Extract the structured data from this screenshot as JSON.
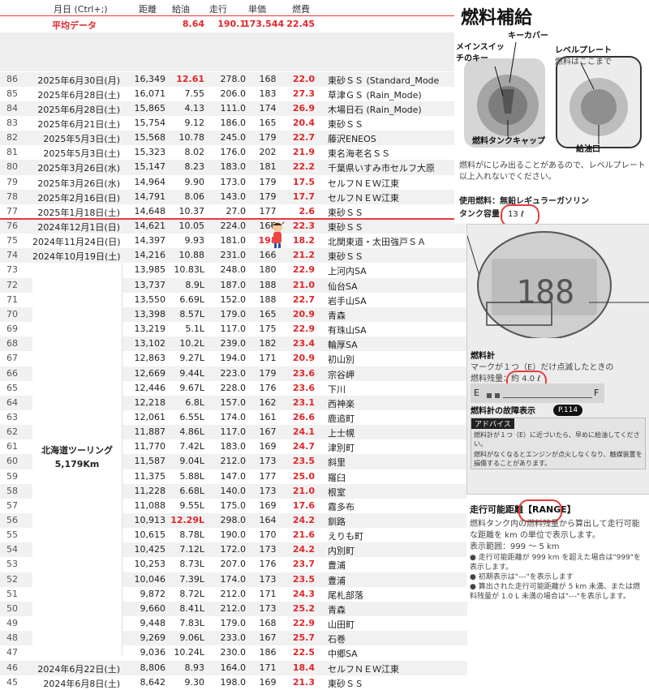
{
  "header": {
    "date": "月日 (Ctrl+;)",
    "dist": "距離",
    "fuel": "給油",
    "trip": "走行",
    "unit": "単価",
    "eff": "燃費"
  },
  "average": {
    "label": "平均データ",
    "fuel": "8.64",
    "trip": "190.1",
    "unit": "173.544",
    "eff": "22.45"
  },
  "hokkaido": {
    "title": "北海道ツーリング",
    "distance": "5,179Km"
  },
  "rows": [
    {
      "no": "86",
      "date": "2025年6月30日(月)",
      "dist": "16,349",
      "fuel": "12.61",
      "trip": "278.0",
      "unit": "168",
      "eff": "22.0",
      "place": "東砂ＳＳ (Standard_Mode",
      "fuel_red": true
    },
    {
      "no": "85",
      "date": "2025年6月28日(土)",
      "dist": "16,071",
      "fuel": "7.55",
      "trip": "206.0",
      "unit": "183",
      "eff": "27.3",
      "place": "草津ＧＳ (Rain_Mode)"
    },
    {
      "no": "84",
      "date": "2025年6月28日(土)",
      "dist": "15,865",
      "fuel": "4.13",
      "trip": "111.0",
      "unit": "174",
      "eff": "26.9",
      "place": "木場日石 (Rain_Mode)"
    },
    {
      "no": "83",
      "date": "2025年6月21日(土)",
      "dist": "15,754",
      "fuel": "9.12",
      "trip": "186.0",
      "unit": "165",
      "eff": "20.4",
      "place": "東砂ＳＳ"
    },
    {
      "no": "82",
      "date": "2025年5月3日(土)",
      "dist": "15,568",
      "fuel": "10.78",
      "trip": "245.0",
      "unit": "179",
      "eff": "22.7",
      "place": "藤沢ENEOS"
    },
    {
      "no": "81",
      "date": "2025年5月3日(土)",
      "dist": "15,323",
      "fuel": "8.02",
      "trip": "176.0",
      "unit": "202",
      "eff": "21.9",
      "place": "東名海老名ＳＳ"
    },
    {
      "no": "80",
      "date": "2025年3月26日(水)",
      "dist": "15,147",
      "fuel": "8.23",
      "trip": "183.0",
      "unit": "181",
      "eff": "22.2",
      "place": "千葉県いすみ市セルフ大原"
    },
    {
      "no": "79",
      "date": "2025年3月26日(水)",
      "dist": "14,964",
      "fuel": "9.90",
      "trip": "173.0",
      "unit": "179",
      "eff": "17.5",
      "place": "セルフＮＥＷ江東"
    },
    {
      "no": "78",
      "date": "2025年2月16日(日)",
      "dist": "14,791",
      "fuel": "8.06",
      "trip": "143.0",
      "unit": "179",
      "eff": "17.7",
      "place": "セルフＮＥＷ江東"
    },
    {
      "no": "77",
      "date": "2025年1月18日(土)",
      "dist": "14,648",
      "fuel": "10.37",
      "trip": "27.0",
      "unit": "177",
      "eff": "2.6",
      "place": "東砂ＳＳ"
    },
    {
      "no": "76",
      "date": "2024年12月1日(日)",
      "dist": "14,621",
      "fuel": "10.05",
      "trip": "224.0",
      "unit": "166",
      "eff": "22.3",
      "place": "東砂ＳＳ"
    },
    {
      "no": "75",
      "date": "2024年11月24日(日)",
      "dist": "14,397",
      "fuel": "9.93",
      "trip": "181.0",
      "unit": "198",
      "eff": "18.2",
      "place": "北関東道・太田強戸ＳＡ",
      "unit_red": true
    },
    {
      "no": "74",
      "date": "2024年10月19日(土)",
      "dist": "14,216",
      "fuel": "10.88",
      "trip": "231.0",
      "unit": "166",
      "eff": "21.2",
      "place": "東砂ＳＳ"
    },
    {
      "no": "73",
      "date": "",
      "dist": "13,985",
      "fuel": "10.83L",
      "trip": "248.0",
      "unit": "180",
      "eff": "22.9",
      "place": "上河内SA"
    },
    {
      "no": "72",
      "date": "",
      "dist": "13,737",
      "fuel": "8.9L",
      "trip": "187.0",
      "unit": "188",
      "eff": "21.0",
      "place": "仙台SA"
    },
    {
      "no": "71",
      "date": "",
      "dist": "13,550",
      "fuel": "6.69L",
      "trip": "152.0",
      "unit": "188",
      "eff": "22.7",
      "place": "岩手山SA"
    },
    {
      "no": "70",
      "date": "",
      "dist": "13,398",
      "fuel": "8.57L",
      "trip": "179.0",
      "unit": "165",
      "eff": "20.9",
      "place": "青森"
    },
    {
      "no": "69",
      "date": "",
      "dist": "13,219",
      "fuel": "5.1L",
      "trip": "117.0",
      "unit": "175",
      "eff": "22.9",
      "place": "有珠山SA"
    },
    {
      "no": "68",
      "date": "",
      "dist": "13,102",
      "fuel": "10.2L",
      "trip": "239.0",
      "unit": "182",
      "eff": "23.4",
      "place": "輪厚SA"
    },
    {
      "no": "67",
      "date": "",
      "dist": "12,863",
      "fuel": "9.27L",
      "trip": "194.0",
      "unit": "171",
      "eff": "20.9",
      "place": "初山別"
    },
    {
      "no": "66",
      "date": "",
      "dist": "12,669",
      "fuel": "9.44L",
      "trip": "223.0",
      "unit": "179",
      "eff": "23.6",
      "place": "宗谷岬"
    },
    {
      "no": "65",
      "date": "",
      "dist": "12,446",
      "fuel": "9.67L",
      "trip": "228.0",
      "unit": "176",
      "eff": "23.6",
      "place": "下川"
    },
    {
      "no": "64",
      "date": "",
      "dist": "12,218",
      "fuel": "6.8L",
      "trip": "157.0",
      "unit": "162",
      "eff": "23.1",
      "place": "西神楽"
    },
    {
      "no": "63",
      "date": "",
      "dist": "12,061",
      "fuel": "6.55L",
      "trip": "174.0",
      "unit": "161",
      "eff": "26.6",
      "place": "鹿追町"
    },
    {
      "no": "62",
      "date": "",
      "dist": "11,887",
      "fuel": "4.86L",
      "trip": "117.0",
      "unit": "167",
      "eff": "24.1",
      "place": "上士幌"
    },
    {
      "no": "61",
      "date": "",
      "dist": "11,770",
      "fuel": "7.42L",
      "trip": "183.0",
      "unit": "169",
      "eff": "24.7",
      "place": "津別町"
    },
    {
      "no": "60",
      "date": "",
      "dist": "11,587",
      "fuel": "9.04L",
      "trip": "212.0",
      "unit": "173",
      "eff": "23.5",
      "place": "斜里"
    },
    {
      "no": "59",
      "date": "",
      "dist": "11,375",
      "fuel": "5.88L",
      "trip": "147.0",
      "unit": "177",
      "eff": "25.0",
      "place": "羅臼"
    },
    {
      "no": "58",
      "date": "",
      "dist": "11,228",
      "fuel": "6.68L",
      "trip": "140.0",
      "unit": "173",
      "eff": "21.0",
      "place": "根室"
    },
    {
      "no": "57",
      "date": "",
      "dist": "11,088",
      "fuel": "9.55L",
      "trip": "175.0",
      "unit": "169",
      "eff": "17.6",
      "place": "霧多布"
    },
    {
      "no": "56",
      "date": "",
      "dist": "10,913",
      "fuel": "12.29L",
      "trip": "298.0",
      "unit": "164",
      "eff": "24.2",
      "place": "釧路",
      "fuel_red": true
    },
    {
      "no": "55",
      "date": "",
      "dist": "10,615",
      "fuel": "8.78L",
      "trip": "190.0",
      "unit": "170",
      "eff": "21.6",
      "place": "えりも町"
    },
    {
      "no": "54",
      "date": "",
      "dist": "10,425",
      "fuel": "7.12L",
      "trip": "172.0",
      "unit": "173",
      "eff": "24.2",
      "place": "内別町"
    },
    {
      "no": "53",
      "date": "",
      "dist": "10,253",
      "fuel": "8.73L",
      "trip": "207.0",
      "unit": "176",
      "eff": "23.7",
      "place": "豊浦"
    },
    {
      "no": "52",
      "date": "",
      "dist": "10,046",
      "fuel": "7.39L",
      "trip": "174.0",
      "unit": "173",
      "eff": "23.5",
      "place": "豊浦"
    },
    {
      "no": "51",
      "date": "",
      "dist": "9,872",
      "fuel": "8.72L",
      "trip": "212.0",
      "unit": "171",
      "eff": "24.3",
      "place": "尾札部落"
    },
    {
      "no": "50",
      "date": "",
      "dist": "9,660",
      "fuel": "8.41L",
      "trip": "212.0",
      "unit": "173",
      "eff": "25.2",
      "place": "青森"
    },
    {
      "no": "49",
      "date": "",
      "dist": "9,448",
      "fuel": "7.83L",
      "trip": "179.0",
      "unit": "168",
      "eff": "22.9",
      "place": "山田町"
    },
    {
      "no": "48",
      "date": "",
      "dist": "9,269",
      "fuel": "9.06L",
      "trip": "233.0",
      "unit": "167",
      "eff": "25.7",
      "place": "石巻"
    },
    {
      "no": "47",
      "date": "",
      "dist": "9,036",
      "fuel": "10.24L",
      "trip": "230.0",
      "unit": "186",
      "eff": "22.5",
      "place": "中郷SA"
    },
    {
      "no": "46",
      "date": "2024年6月22日(土)",
      "dist": "8,806",
      "fuel": "8.93",
      "trip": "164.0",
      "unit": "171",
      "eff": "18.4",
      "place": "セルフＮＥＷ江東"
    },
    {
      "no": "45",
      "date": "2024年6月8日(土)",
      "dist": "8,642",
      "fuel": "9.30",
      "trip": "198.0",
      "unit": "169",
      "eff": "21.3",
      "place": "東砂ＳＳ"
    }
  ],
  "manual": {
    "title": "燃料補給",
    "key_cover": "キーカバー",
    "main_switch": "メインスイッチのキー",
    "level_plate": "レベルプレート",
    "level_plate_note": "燃料はここまで",
    "fuel_cap": "燃料タンクキャップ",
    "filler": "給油口",
    "note": "燃料がにじみ出ることがあるので、レベルプレート以上入れないでください。",
    "fuel_type": "使用燃料：無鉛レギュラーガソリン",
    "tank_label": "タンク容量：",
    "tank_value": "13 ℓ",
    "gauge_title": "燃料計",
    "gauge_desc": "マークが１つ（E）だけ点滅したときの",
    "gauge_remain_label": "燃料残量：",
    "gauge_remain_value": "約 4.0 ℓ",
    "gauge_E": "E",
    "gauge_F": "F",
    "fault_label": "燃料計の故障表示",
    "fault_ref": "P.114",
    "advice_title": "アドバイス",
    "advice1": "燃料計が１つ（E）に近づいたら、早めに給油してください。",
    "advice2": "燃料がなくなるとエンジンが点火しなくなり、触媒装置を損傷することがあります。",
    "range_title": "走行可能距離",
    "range_tag": "RANGE",
    "range_desc": "燃料タンク内の燃料残量から算出して走行可能な距離を km の単位で表示します。",
    "range_limits": "表示範囲：999 〜 5 km",
    "bullet1": "走行可能距離が 999 km を超えた場合は\"999\"を表示します。",
    "bullet2": "初期表示は\"---\"を表示します",
    "bullet3": "算出された走行可能距離が 5 km 未満、または燃料残量が 1.0 L 未満の場合は\"---\"を表示します。",
    "lcd_digits": "188"
  }
}
